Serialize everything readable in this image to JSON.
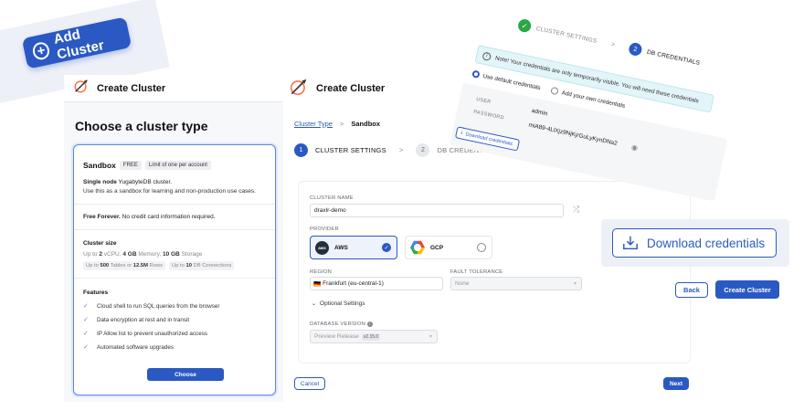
{
  "add_cluster": {
    "label": "Add Cluster"
  },
  "left": {
    "header_title": "Create Cluster",
    "heading": "Choose a cluster type",
    "card": {
      "title": "Sandbox",
      "tag_free": "FREE",
      "tag_limit": "Limit of one per account",
      "desc_bold": "Single node",
      "desc_rest": " YugabyteDB cluster.",
      "desc2": "Use this as a sandbox for learning and non-production use cases.",
      "free_bold": "Free Forever.",
      "free_rest": " No credit card information required.",
      "size_title": "Cluster size",
      "size_line": {
        "p1": "Up to ",
        "v1": "2",
        "u1": " vCPU, ",
        "v2": "4 GB",
        "u2": " Memory, ",
        "v3": "10 GB",
        "u3": " Storage"
      },
      "chip1": {
        "p": "Up to ",
        "v1": "500",
        "m": " Tables or ",
        "v2": "12.5M",
        "s": " Rows"
      },
      "chip2": {
        "p": "Up to ",
        "v": "10",
        "s": " DB Connections"
      },
      "features_title": "Features",
      "features": [
        "Cloud shell to run SQL queries from the browser",
        "Data encryption at rest and in transit",
        "IP Allow list to prevent unauthorized access",
        "Automated software upgrades"
      ],
      "choose_label": "Choose"
    }
  },
  "center": {
    "header_title": "Create Cluster",
    "breadcrumb": {
      "link": "Cluster Type",
      "sep": ">",
      "current": "Sandbox"
    },
    "steps": [
      {
        "num": "1",
        "label": "CLUSTER SETTINGS"
      },
      {
        "num": "2",
        "label": "DB CREDENTIA"
      }
    ],
    "step_sep": ">",
    "form": {
      "cluster_name_label": "CLUSTER NAME",
      "cluster_name_value": "draxlr-demo",
      "provider_label": "PROVIDER",
      "providers": [
        "AWS",
        "GCP"
      ],
      "aws_logo_text": "aws",
      "region_label": "REGION",
      "region_value": "Frankfurt (eu-central-1)",
      "region_flag": "🇩🇪",
      "fault_label": "FAULT TOLERANCE",
      "fault_value": "None",
      "optional_label": "Optional Settings",
      "db_version_label": "DATABASE VERSION",
      "db_version_value": "Preview Release",
      "db_version_tag": "v2.15.0"
    },
    "cancel_label": "Cancel",
    "next_label": "Next"
  },
  "credentials": {
    "step1": "CLUSTER SETTINGS",
    "step2_num": "2",
    "step2": "DB CREDENTIALS",
    "sep": ">",
    "note": "Note! Your credentials are only temporarily visible. You will need these credentials",
    "opt_default": "Use default credentials",
    "opt_own": "Add your own credentials",
    "user_key": "USER",
    "user_val": "admin",
    "password_key": "PASSWORD",
    "password_val": "miA89-4LlXjz9NjKjrGuLyKynDNa2",
    "download_small": "Download credentials"
  },
  "download_big": {
    "label": "Download credentials"
  },
  "actions": {
    "back": "Back",
    "create": "Create Cluster"
  },
  "colors": {
    "accent": "#2b59c3",
    "success": "#28a745",
    "panel_bg": "#f7f8fa",
    "note_bg": "#e3f5f9"
  }
}
